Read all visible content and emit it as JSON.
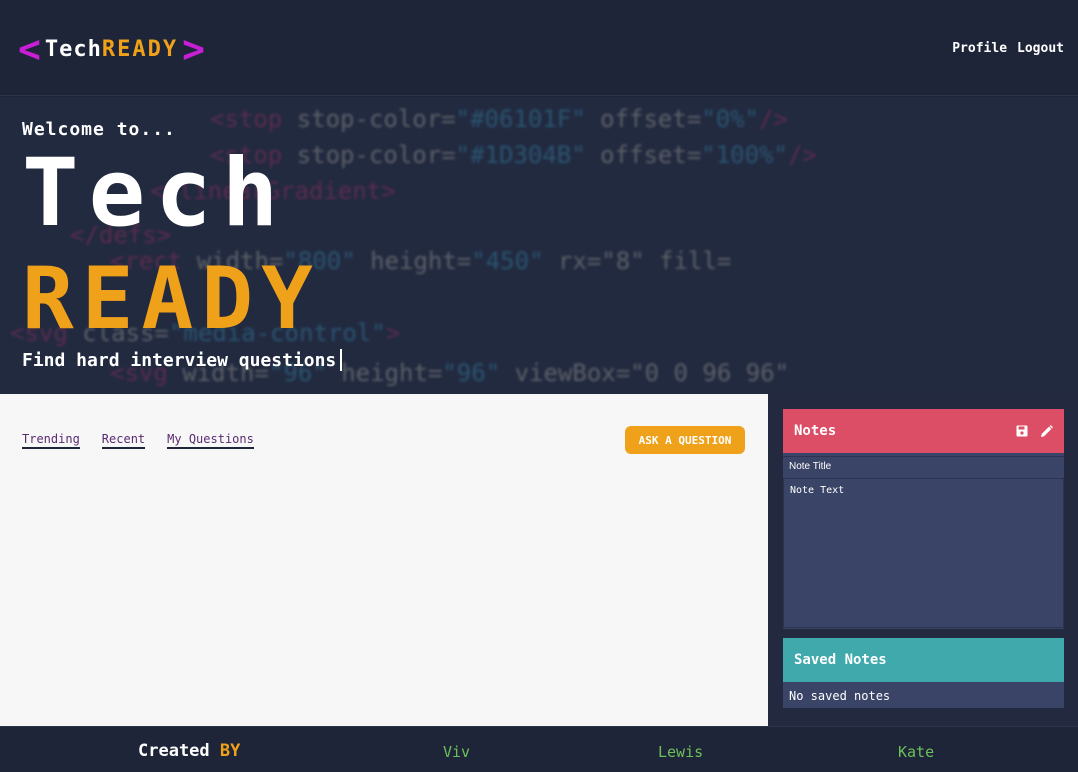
{
  "header": {
    "logo": {
      "open_bracket": "<",
      "tech": "Tech",
      "ready": "READY",
      "close_bracket": ">"
    },
    "nav": {
      "profile": "Profile",
      "logout": "Logout"
    }
  },
  "hero": {
    "welcome": "Welcome to...",
    "title_tech": "Tech",
    "title_ready": "READY",
    "tagline": "Find hard interview questions",
    "background_code": [
      {
        "tag": "<stop",
        "attr": " stop-color=",
        "str": "\"#06101F\"",
        "attr2": " offset=",
        "str2": "\"0%\"",
        "end": "/>"
      },
      {
        "tag": "<stop",
        "attr": " stop-color=",
        "str": "\"#1D304B\"",
        "attr2": " offset=",
        "str2": "\"100%\"",
        "end": "/>"
      },
      {
        "tag": "</linearGradient>",
        "attr": "",
        "str": "",
        "attr2": "",
        "str2": "",
        "end": ""
      },
      {
        "tag": "</defs>",
        "attr": "",
        "str": "",
        "attr2": "",
        "str2": "",
        "end": ""
      },
      {
        "tag": "<rect",
        "attr": " width=",
        "str": "\"800\"",
        "attr2": " height=",
        "str2": "\"450\"",
        "end": " rx=\"8\" fill="
      },
      {
        "tag": "<svg",
        "attr": " class=",
        "str": "\"media-control\"",
        "attr2": "",
        "str2": "",
        "end": ">"
      },
      {
        "tag": "<svg",
        "attr": " width=",
        "str": "\"96\"",
        "attr2": " height=",
        "str2": "\"96\"",
        "end": " viewBox=\"0 0 96 96\""
      }
    ]
  },
  "main": {
    "tabs": [
      "Trending",
      "Recent",
      "My Questions"
    ],
    "ask_button": "ASK A QUESTION"
  },
  "notes": {
    "title": "Notes",
    "title_placeholder": "Note Title",
    "text_placeholder": "Note Text",
    "save_icon": "save-icon",
    "edit_icon": "pencil-icon"
  },
  "saved_notes": {
    "title": "Saved Notes",
    "empty": "No saved notes"
  },
  "footer": {
    "created": "Created",
    "by": "BY",
    "names": [
      "Viv",
      "Lewis",
      "Kate"
    ]
  },
  "colors": {
    "background": "#1f2538",
    "accent_orange": "#f0a11a",
    "accent_magenta": "#c81fd6",
    "notes_header": "#dc4d66",
    "saved_header": "#3fa9ab",
    "panel": "#3a4466",
    "name_green": "#6cc05a"
  }
}
